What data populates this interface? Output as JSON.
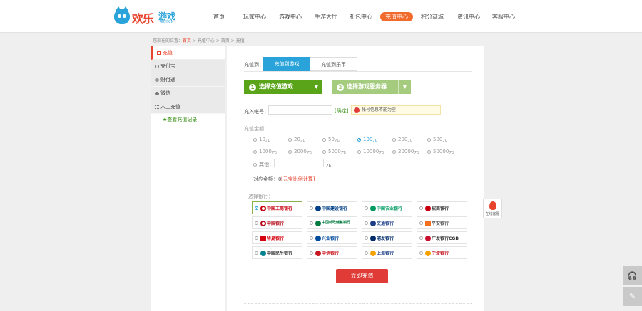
{
  "brand": {
    "name_cn": "欢乐",
    "name_game": "游戏",
    "domain": "4JOY.CN"
  },
  "nav": [
    "首页",
    "玩家中心",
    "游戏中心",
    "手游大厅",
    "礼包中心",
    "充值中心",
    "积分商城",
    "资讯中心",
    "客服中心"
  ],
  "nav_active": 5,
  "breadcrumb": {
    "prefix": "您现在的位置：",
    "home": "首页",
    "sep1": " > 充值中心 > ",
    "current": "首页",
    "sep2": " > 充值"
  },
  "sidebar": {
    "top": "充值",
    "items": [
      "支付宝",
      "财付通",
      "微信",
      "人工充值"
    ],
    "link": "★查看充值记录"
  },
  "tabs": {
    "label": "充值到：",
    "to_game": "充值到游戏",
    "to_platform": "充值到乐币"
  },
  "steps": {
    "one_num": "1",
    "one": "选择充值游戏",
    "two_num": "2",
    "two": "选择游戏服务器"
  },
  "account": {
    "label": "充入帐号：",
    "confirm": "[确定]",
    "warning": "帐号信息不能为空"
  },
  "amount": {
    "label": "充值金额：",
    "options": [
      "10元",
      "20元",
      "50元",
      "100元",
      "200元",
      "500元",
      "1000元",
      "2000元",
      "5000元",
      "10000元",
      "20000元",
      "50000元"
    ],
    "selected": "100元",
    "other": "其他：",
    "unit": "元",
    "equal_prefix": "对应金额：0",
    "equal_link": "[元宝比例计算]"
  },
  "bank": {
    "label": "选择银行：",
    "items": [
      "中国工商银行",
      "中国建设银行",
      "中国农业银行",
      "招商银行",
      "中国银行",
      "中国邮政储蓄银行",
      "交通银行",
      "平安银行",
      "华夏银行",
      "兴业银行",
      "浦发银行",
      "广发银行CGB",
      "中国民生银行",
      "中信银行",
      "上海银行",
      "宁波银行"
    ],
    "selected": "中国工商银行"
  },
  "submit": "立即充值",
  "float": {
    "qq": "在线客服",
    "headset": "🎧",
    "edit": "✎"
  },
  "colors": {
    "accent": "#e8432d",
    "green": "#5aa41a",
    "nav_active": "#f26b2e",
    "blue": "#29a3d9"
  }
}
